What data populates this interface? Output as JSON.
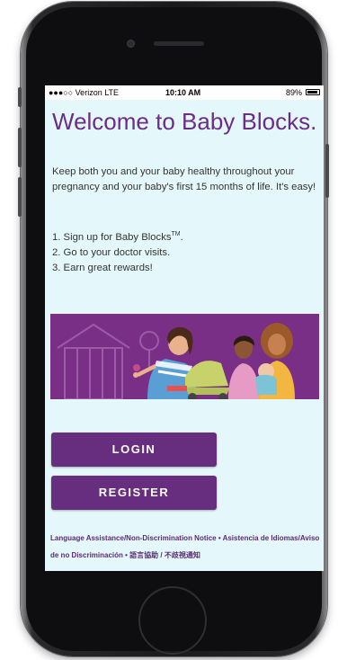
{
  "status_bar": {
    "carrier": "●●●○○ Verizon  LTE",
    "time": "10:10 AM",
    "battery": "89%"
  },
  "page": {
    "title": "Welcome to Baby Blocks.",
    "intro": "Keep both you and your baby healthy throughout your pregnancy and your baby's first 15 months of life. It's easy!",
    "steps": [
      {
        "text": "1. Sign up for Baby Blocks",
        "sup": "TM",
        "suffix": "."
      },
      {
        "text": "2. Go to your doctor visits."
      },
      {
        "text": "3. Earn great rewards!"
      }
    ]
  },
  "buttons": {
    "login": "LOGIN",
    "register": "REGISTER"
  },
  "footer": {
    "notice": "Language Assistance/Non-Discrimination Notice • Asistencia de Idiomas/Aviso de no Discriminación • 語言協助 / 不歧視通知"
  },
  "colors": {
    "brand_purple": "#672d7f",
    "title_purple": "#6b2d88",
    "screen_bg": "#e4f8fb",
    "banner_bg": "#7a2f86"
  },
  "icons": {
    "banner": "family-illustration"
  }
}
